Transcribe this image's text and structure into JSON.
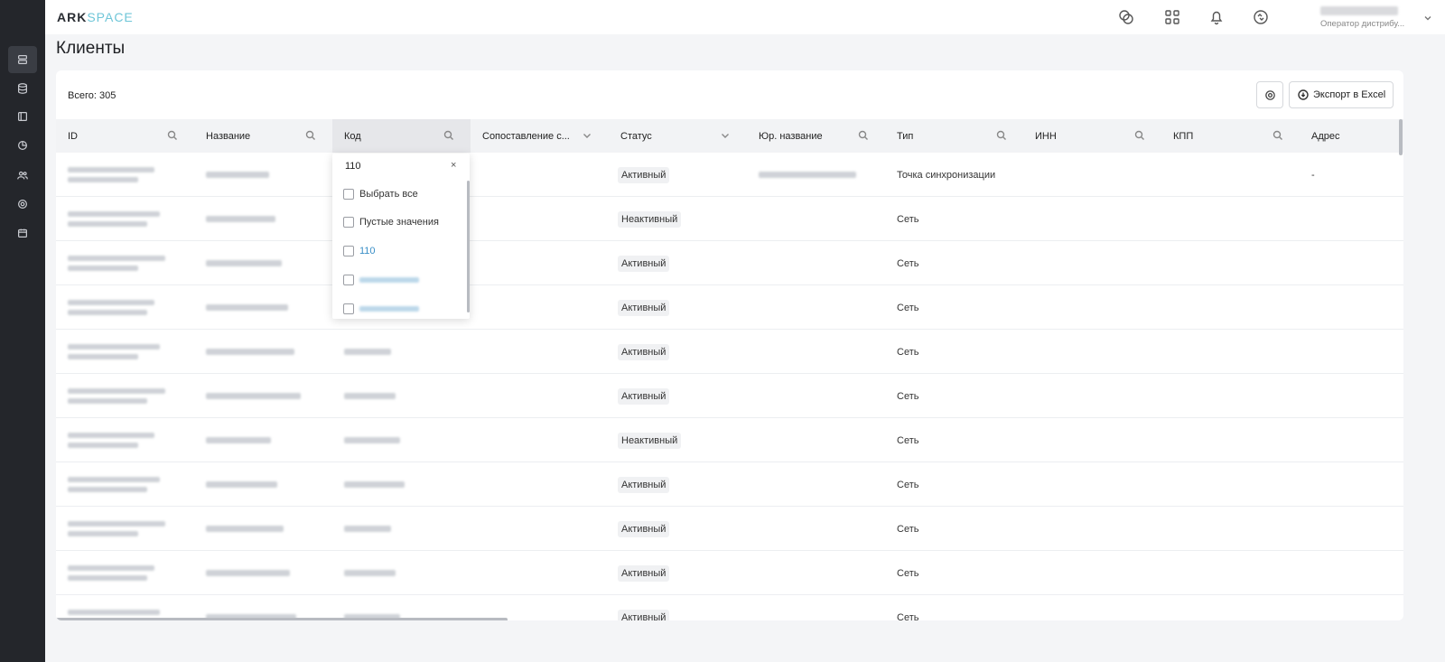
{
  "brand": {
    "logo_a": "ARK",
    "logo_b": "SPACE"
  },
  "rail_icons": [
    "servers-icon",
    "database-icon",
    "layout-icon",
    "chart-pie-icon",
    "users-icon",
    "gear-icon",
    "calendar-icon"
  ],
  "topbar": {
    "icons": [
      "chat-icon",
      "apps-grid-icon",
      "bell-icon",
      "sync-icon"
    ],
    "user_role": "Оператор дистрибу..."
  },
  "page": {
    "title": "Клиенты"
  },
  "toolbar": {
    "total": "Всего: 305",
    "export_label": "Экспорт в Excel"
  },
  "columns": [
    {
      "label": "ID",
      "icon": "search-icon"
    },
    {
      "label": "Название",
      "icon": "search-icon"
    },
    {
      "label": "Код",
      "icon": "search-icon",
      "active": true
    },
    {
      "label": "Сопоставление с...",
      "icon": "chevron-down-icon"
    },
    {
      "label": "Статус",
      "icon": "chevron-down-icon"
    },
    {
      "label": "Юр. название",
      "icon": "search-icon"
    },
    {
      "label": "Тип",
      "icon": "search-icon"
    },
    {
      "label": "ИНН",
      "icon": "search-icon"
    },
    {
      "label": "КПП",
      "icon": "search-icon"
    },
    {
      "label": "Адрес",
      "icon": ""
    }
  ],
  "rows": [
    {
      "status": "Активный",
      "type": "Точка синхронизации",
      "address": "-"
    },
    {
      "status": "Неактивный",
      "type": "Сеть",
      "address": ""
    },
    {
      "status": "Активный",
      "type": "Сеть",
      "address": ""
    },
    {
      "status": "Активный",
      "type": "Сеть",
      "address": ""
    },
    {
      "status": "Активный",
      "type": "Сеть",
      "address": ""
    },
    {
      "status": "Активный",
      "type": "Сеть",
      "address": ""
    },
    {
      "status": "Неактивный",
      "type": "Сеть",
      "address": ""
    },
    {
      "status": "Активный",
      "type": "Сеть",
      "address": ""
    },
    {
      "status": "Активный",
      "type": "Сеть",
      "address": ""
    },
    {
      "status": "Активный",
      "type": "Сеть",
      "address": ""
    },
    {
      "status": "Активный",
      "type": "Сеть",
      "address": ""
    }
  ],
  "filter": {
    "query": "110",
    "clear": "×",
    "select_all": "Выбрать все",
    "empty_values": "Пустые значения",
    "value_1": "110"
  }
}
